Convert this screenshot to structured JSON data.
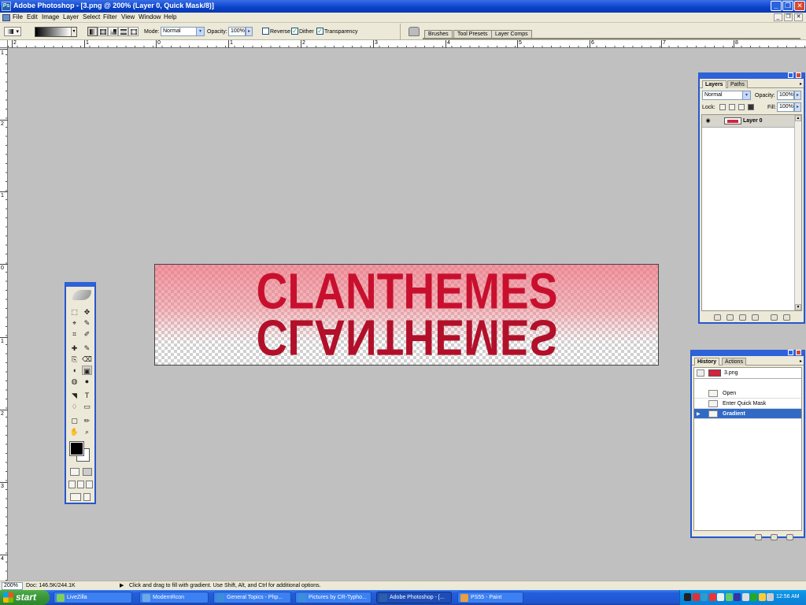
{
  "window": {
    "title": "Adobe Photoshop - [3.png @ 200% (Layer 0, Quick Mask/8)]",
    "controls": [
      "_",
      "❐",
      "✕"
    ]
  },
  "menu": {
    "items": [
      "File",
      "Edit",
      "Image",
      "Layer",
      "Select",
      "Filter",
      "View",
      "Window",
      "Help"
    ],
    "doc_controls": [
      "_",
      "❐",
      "✕"
    ]
  },
  "options": {
    "mode_label": "Mode:",
    "mode_value": "Normal",
    "opacity_label": "Opacity:",
    "opacity_value": "100%",
    "reverse_label": "Reverse",
    "reverse_checked": false,
    "dither_label": "Dither",
    "dither_checked": true,
    "transparency_label": "Transparency",
    "transparency_checked": true,
    "check_mark": "✓"
  },
  "palette_well": {
    "tabs": [
      "Brushes",
      "Tool Presets",
      "Layer Comps"
    ]
  },
  "rulers": {
    "horizontal": [
      "2",
      "1",
      "0",
      "1",
      "2",
      "3",
      "4",
      "5",
      "6",
      "7",
      "8"
    ],
    "vertical": [
      "1",
      "2",
      "1",
      "0",
      "1",
      "2",
      "3",
      "4"
    ]
  },
  "canvas": {
    "text": "CLANTHEMES",
    "text_color": "#c8102e",
    "gradient_color": "#f07282"
  },
  "tools": {
    "glyphs": [
      "⬚",
      "✥",
      "⌖",
      "✎",
      "⌗",
      "✐",
      "✚",
      "✎",
      "⎘",
      "⌫",
      "◖",
      "▣",
      "◍",
      "●",
      "◥",
      "T",
      "♢",
      "▭",
      "▢",
      "✏",
      "✋",
      "⌕"
    ]
  },
  "layers_panel": {
    "tabs": [
      "Layers",
      "Paths"
    ],
    "blend_mode": "Normal",
    "opacity_label": "Opacity:",
    "opacity_value": "100%",
    "lock_label": "Lock:",
    "fill_label": "Fill:",
    "fill_value": "100%",
    "layers": [
      {
        "name": "Layer 0",
        "visible": true
      }
    ]
  },
  "history_panel": {
    "tabs": [
      "History",
      "Actions"
    ],
    "snapshot": "3.png",
    "states": [
      {
        "label": "Open",
        "selected": false
      },
      {
        "label": "Enter Quick Mask",
        "selected": false
      },
      {
        "label": "Gradient",
        "selected": true
      }
    ]
  },
  "statusbar": {
    "zoom": "200%",
    "doc_info": "Doc: 146.5K/244.1K",
    "hint": "Click and drag to fill with gradient.  Use Shift, Alt, and Ctrl for additional options."
  },
  "taskbar": {
    "start_label": "start",
    "tasks": [
      {
        "label": "LiveZilla",
        "icon_color": "#7fcf5a",
        "active": false
      },
      {
        "label": "ModernRcon",
        "icon_color": "#6fa8e8",
        "active": false
      },
      {
        "label": "General Topics - Php...",
        "icon_color": "#3b8fd8",
        "active": false
      },
      {
        "label": "Pictures by CR-Typho...",
        "icon_color": "#3b8fd8",
        "active": false
      },
      {
        "label": "Adobe Photoshop - [...",
        "icon_color": "#2b5fa8",
        "active": true
      },
      {
        "label": "PS55 - Paint",
        "icon_color": "#e8a040",
        "active": false
      }
    ],
    "tray_colors": [
      "#222",
      "#d33",
      "#39c",
      "#e33",
      "#eee",
      "#6c6",
      "#33a",
      "#ddd",
      "#2a2",
      "#fc3",
      "#ccc"
    ],
    "clock": "12:56 AM"
  }
}
